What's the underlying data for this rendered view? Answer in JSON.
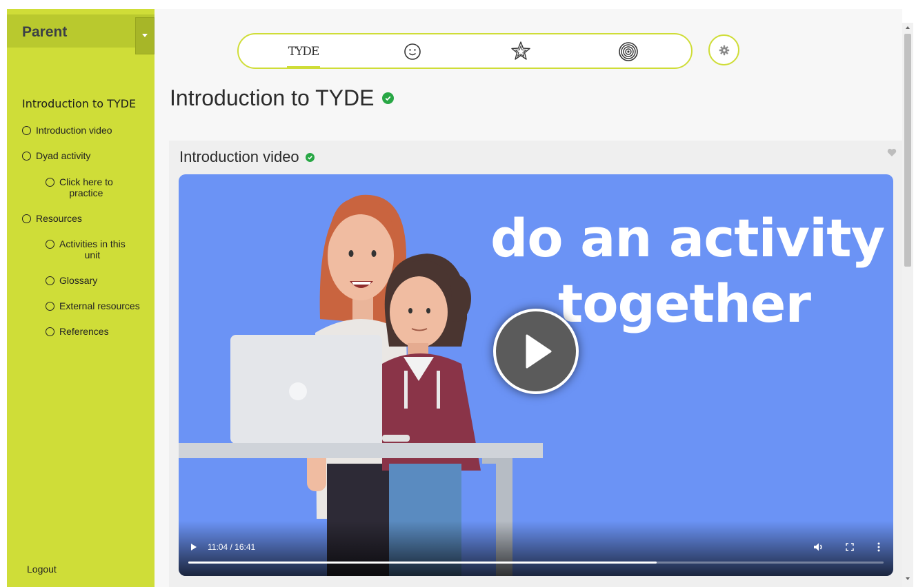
{
  "sidebar": {
    "role_label": "Parent",
    "heading": "Introduction to TYDE",
    "items": [
      {
        "label": "Introduction video"
      },
      {
        "label": "Dyad activity"
      },
      {
        "label": "Click here to practice",
        "lines": [
          "Click here to",
          "practice"
        ]
      },
      {
        "label": "Resources"
      },
      {
        "label": "Activities in this unit",
        "lines": [
          "Activities in this",
          "unit"
        ]
      },
      {
        "label": "Glossary"
      },
      {
        "label": "External resources"
      },
      {
        "label": "References"
      }
    ],
    "logout_label": "Logout"
  },
  "topnav": {
    "logo_text": "TYDE",
    "tabs": [
      {
        "icon": "tyde-logo-icon",
        "active": true
      },
      {
        "icon": "smiley-icon",
        "active": false
      },
      {
        "icon": "star-icon",
        "active": false
      },
      {
        "icon": "target-icon",
        "active": false
      }
    ],
    "settings_icon": "gear-icon"
  },
  "page": {
    "title": "Introduction to TYDE",
    "completed": true
  },
  "card": {
    "title": "Introduction video",
    "completed": true
  },
  "video": {
    "caption_line1": "do an activity",
    "caption_line2": "together",
    "time_display": "11:04 / 16:41",
    "progress_fraction": 0.674
  },
  "colors": {
    "accent": "#cfdd38",
    "check": "#28a745",
    "video_bg": "#6b93f5"
  }
}
